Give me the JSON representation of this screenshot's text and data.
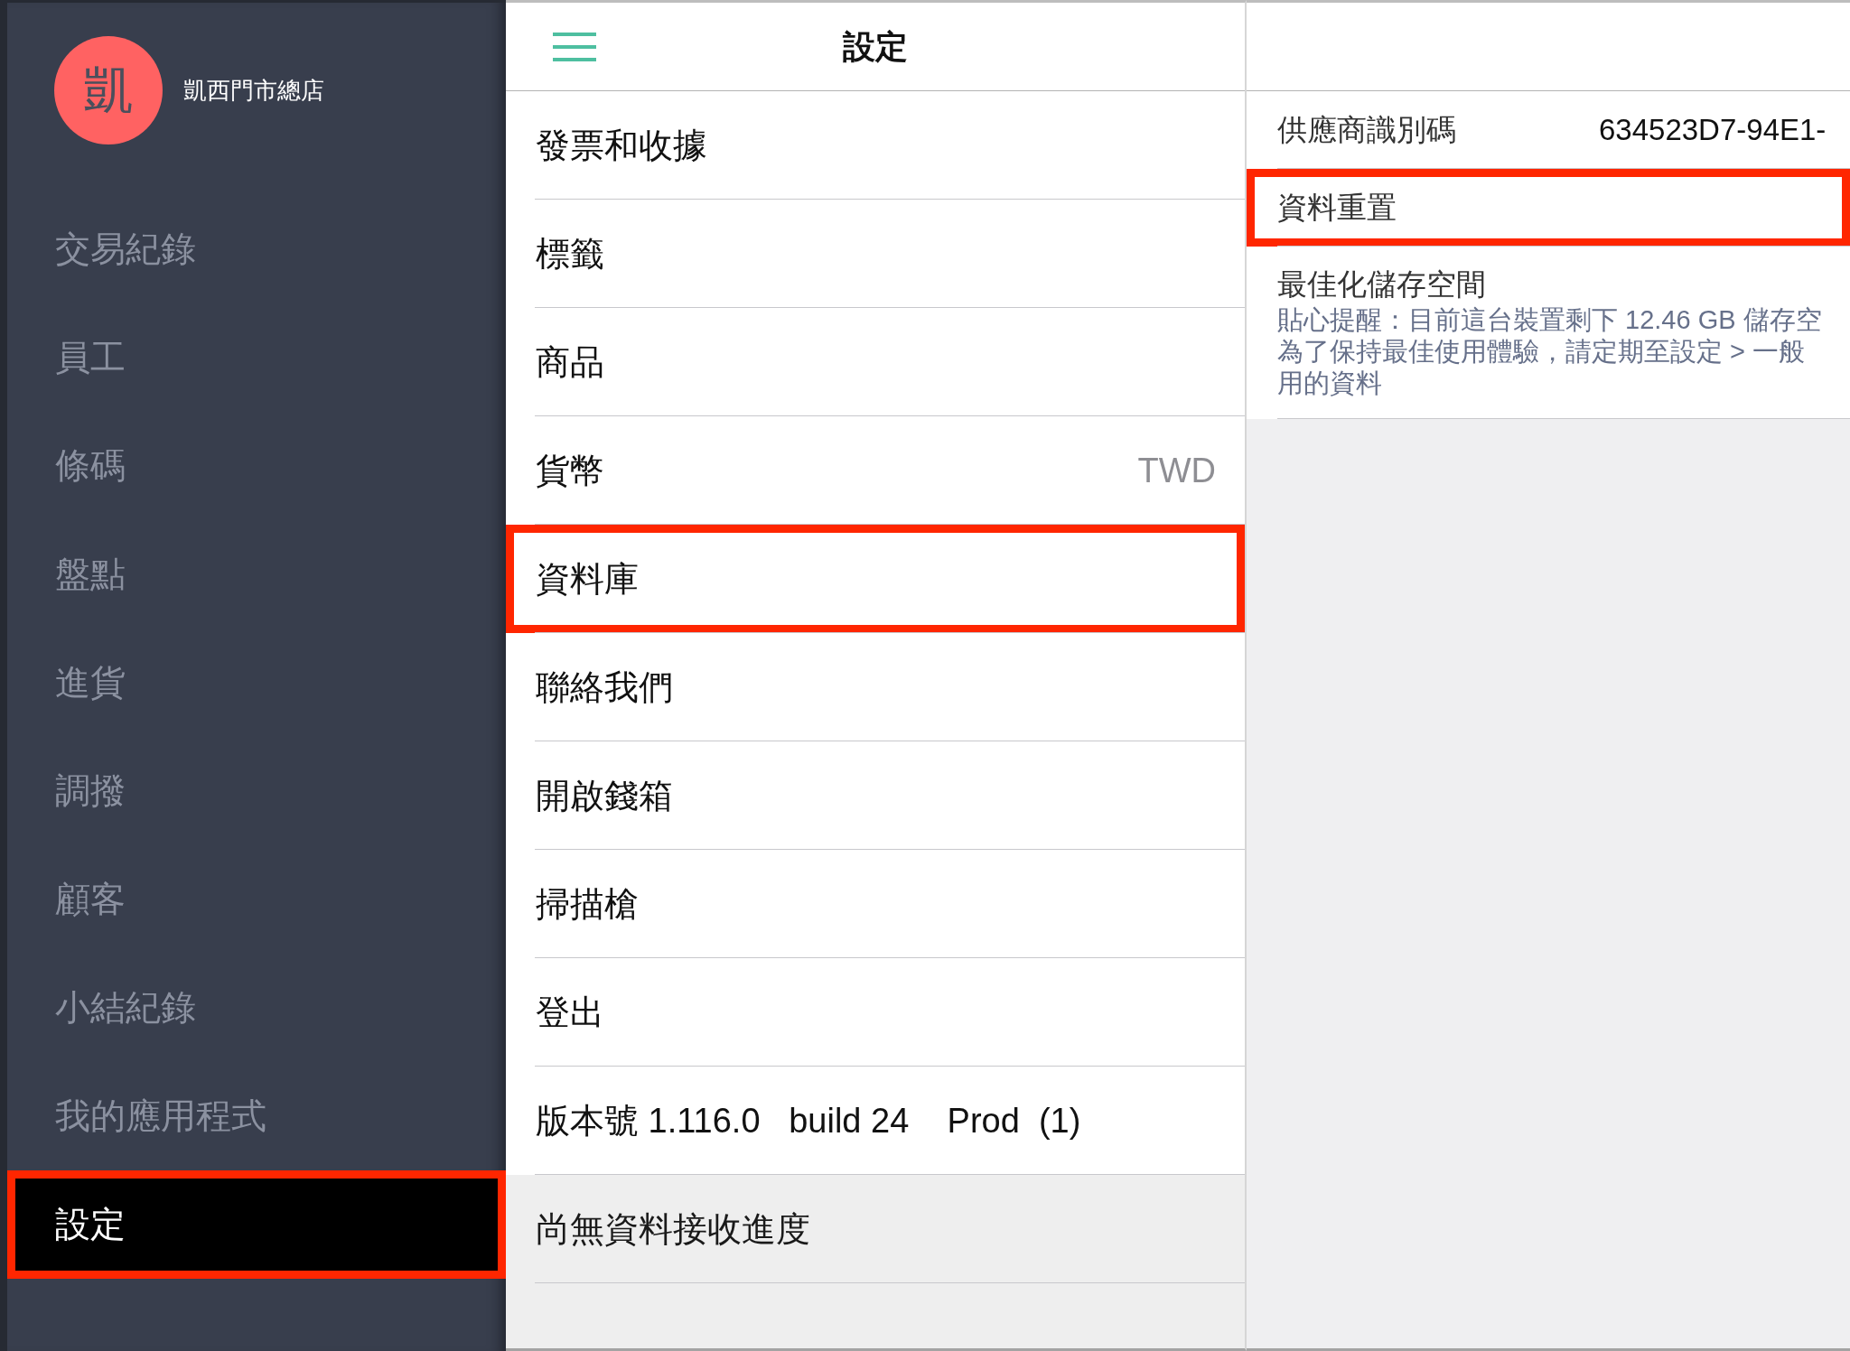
{
  "sidebar": {
    "avatar": {
      "letter": "凱"
    },
    "store_name": "凱西門市總店",
    "items": [
      {
        "label": "交易紀錄",
        "selected": false,
        "highlighted": false
      },
      {
        "label": "員工",
        "selected": false,
        "highlighted": false
      },
      {
        "label": "條碼",
        "selected": false,
        "highlighted": false
      },
      {
        "label": "盤點",
        "selected": false,
        "highlighted": false
      },
      {
        "label": "進貨",
        "selected": false,
        "highlighted": false
      },
      {
        "label": "調撥",
        "selected": false,
        "highlighted": false
      },
      {
        "label": "顧客",
        "selected": false,
        "highlighted": false
      },
      {
        "label": "小結紀錄",
        "selected": false,
        "highlighted": false
      },
      {
        "label": "我的應用程式",
        "selected": false,
        "highlighted": false
      },
      {
        "label": "設定",
        "selected": true,
        "highlighted": true
      }
    ]
  },
  "settings_panel": {
    "title": "設定",
    "items": [
      {
        "kind": "link",
        "label": "發票和收據",
        "highlighted": false
      },
      {
        "kind": "link",
        "label": "標籤",
        "highlighted": false
      },
      {
        "kind": "link",
        "label": "商品",
        "highlighted": false
      },
      {
        "kind": "link",
        "label": "貨幣",
        "value": "TWD",
        "highlighted": false
      },
      {
        "kind": "link",
        "label": "資料庫",
        "highlighted": true
      },
      {
        "kind": "link",
        "label": "聯絡我們",
        "highlighted": false
      },
      {
        "kind": "link",
        "label": "開啟錢箱",
        "highlighted": false
      },
      {
        "kind": "link",
        "label": "掃描槍",
        "highlighted": false
      },
      {
        "kind": "link",
        "label": "登出",
        "highlighted": false
      },
      {
        "kind": "info",
        "label": "版本號 1.116.0   build 24    Prod  (1)",
        "highlighted": false
      }
    ],
    "sync_status": "尚無資料接收進度"
  },
  "detail_panel": {
    "items": [
      {
        "kind": "field",
        "label": "供應商識別碼",
        "value": "634523D7-94E1-",
        "highlighted": false
      },
      {
        "kind": "action",
        "label": "資料重置",
        "highlighted": true
      },
      {
        "kind": "note",
        "label": "最佳化儲存空間",
        "description_lines": [
          "貼心提醒：目前這台裝置剩下 12.46 GB 儲存空",
          "為了保持最佳使用體驗，請定期至設定 > 一般",
          "用的資料"
        ],
        "highlighted": false
      }
    ]
  }
}
